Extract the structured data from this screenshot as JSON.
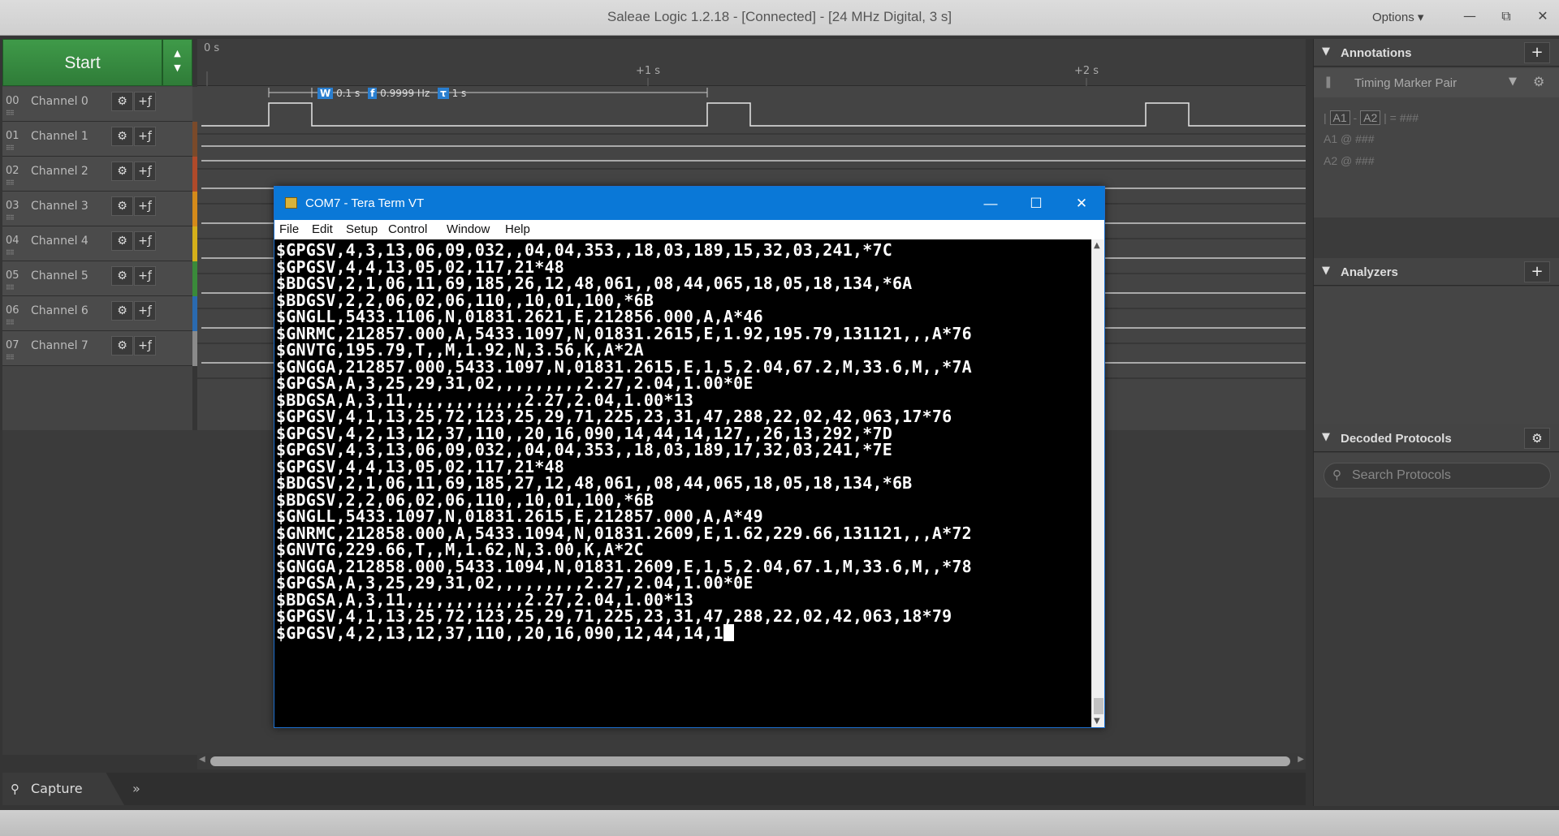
{
  "window": {
    "title": "Saleae Logic 1.2.18 - [Connected] - [24 MHz Digital, 3 s]",
    "options_label": "Options ▾",
    "minimize": "—",
    "restore": "⧉",
    "close": "✕"
  },
  "start_button": {
    "label": "Start"
  },
  "channels": [
    {
      "num": "00",
      "name": "Channel 0",
      "color": "#444444"
    },
    {
      "num": "01",
      "name": "Channel 1",
      "color": "#7a4a2a"
    },
    {
      "num": "02",
      "name": "Channel 2",
      "color": "#b04a2a"
    },
    {
      "num": "03",
      "name": "Channel 3",
      "color": "#d48a1a"
    },
    {
      "num": "04",
      "name": "Channel 4",
      "color": "#d4b01a"
    },
    {
      "num": "05",
      "name": "Channel 5",
      "color": "#3a8a3a"
    },
    {
      "num": "06",
      "name": "Channel 6",
      "color": "#2a6ab0"
    },
    {
      "num": "07",
      "name": "Channel 7",
      "color": "#8a8a8a"
    }
  ],
  "timeline": {
    "start_label": "0 s",
    "mid_label": "+1 s",
    "end_label": "+2 s"
  },
  "measurement": {
    "width_tag": "W",
    "width_value": "0.1 s",
    "freq_tag": "f",
    "freq_value": "0.9999 Hz",
    "period_tag": "τ",
    "period_value": "1 s"
  },
  "tabs": {
    "capture_label": "Capture",
    "more_label": "»"
  },
  "annotations": {
    "title": "Annotations",
    "add": "+",
    "marker_label": "Timing Marker Pair",
    "formula_a1": "A1",
    "formula_a2": "A2",
    "formula_result": "= ###",
    "a1_row": "A1  @  ###",
    "a2_row": "A2  @  ###"
  },
  "analyzers": {
    "title": "Analyzers",
    "add": "+"
  },
  "decoded_protocols": {
    "title": "Decoded Protocols",
    "gear": "⚙",
    "search_placeholder": "Search Protocols"
  },
  "teraterm": {
    "title": "COM7 - Tera Term VT",
    "min": "—",
    "max": "☐",
    "close": "✕",
    "menu": [
      "File",
      "Edit",
      "Setup",
      "Control",
      "Window",
      "Help"
    ],
    "lines": [
      "$GPGSV,4,3,13,06,09,032,,04,04,353,,18,03,189,15,32,03,241,*7C",
      "$GPGSV,4,4,13,05,02,117,21*48",
      "$BDGSV,2,1,06,11,69,185,26,12,48,061,,08,44,065,18,05,18,134,*6A",
      "$BDGSV,2,2,06,02,06,110,,10,01,100,*6B",
      "$GNGLL,5433.1106,N,01831.2621,E,212856.000,A,A*46",
      "$GNRMC,212857.000,A,5433.1097,N,01831.2615,E,1.92,195.79,131121,,,A*76",
      "$GNVTG,195.79,T,,M,1.92,N,3.56,K,A*2A",
      "$GNGGA,212857.000,5433.1097,N,01831.2615,E,1,5,2.04,67.2,M,33.6,M,,*7A",
      "$GPGSA,A,3,25,29,31,02,,,,,,,,,2.27,2.04,1.00*0E",
      "$BDGSA,A,3,11,,,,,,,,,,,,2.27,2.04,1.00*13",
      "$GPGSV,4,1,13,25,72,123,25,29,71,225,23,31,47,288,22,02,42,063,17*76",
      "$GPGSV,4,2,13,12,37,110,,20,16,090,14,44,14,127,,26,13,292,*7D",
      "$GPGSV,4,3,13,06,09,032,,04,04,353,,18,03,189,17,32,03,241,*7E",
      "$GPGSV,4,4,13,05,02,117,21*48",
      "$BDGSV,2,1,06,11,69,185,27,12,48,061,,08,44,065,18,05,18,134,*6B",
      "$BDGSV,2,2,06,02,06,110,,10,01,100,*6B",
      "$GNGLL,5433.1097,N,01831.2615,E,212857.000,A,A*49",
      "$GNRMC,212858.000,A,5433.1094,N,01831.2609,E,1.62,229.66,131121,,,A*72",
      "$GNVTG,229.66,T,,M,1.62,N,3.00,K,A*2C",
      "$GNGGA,212858.000,5433.1094,N,01831.2609,E,1,5,2.04,67.1,M,33.6,M,,*78",
      "$GPGSA,A,3,25,29,31,02,,,,,,,,,2.27,2.04,1.00*0E",
      "$BDGSA,A,3,11,,,,,,,,,,,,2.27,2.04,1.00*13",
      "$GPGSV,4,1,13,25,72,123,25,29,71,225,23,31,47,288,22,02,42,063,18*79",
      "$GPGSV,4,2,13,12,37,110,,20,16,090,12,44,14,1"
    ]
  }
}
